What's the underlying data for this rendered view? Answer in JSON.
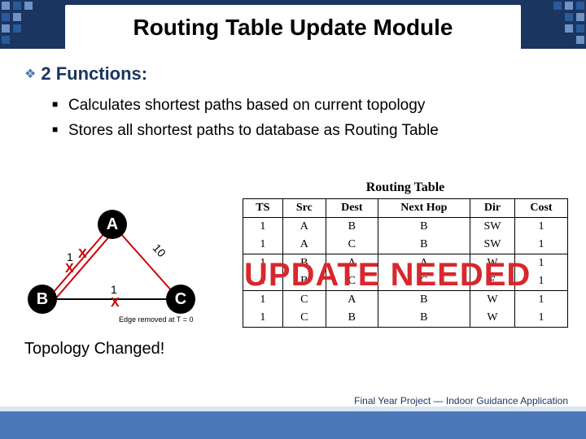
{
  "title": "Routing Table Update Module",
  "section": "2 Functions:",
  "bullets": [
    "Calculates shortest paths based on current topology",
    "Stores all shortest paths to database as Routing Table"
  ],
  "graph": {
    "nodeA": "A",
    "nodeB": "B",
    "nodeC": "C",
    "edgeAB": "1",
    "edgeBC": "1",
    "edgeAC": "10",
    "removed_caption": "Edge removed at T = 0"
  },
  "overlay": "UPDATE NEEDED",
  "topology_note": "Topology Changed!",
  "routing_table": {
    "title": "Routing Table",
    "headers": [
      "TS",
      "Src",
      "Dest",
      "Next Hop",
      "Dir",
      "Cost"
    ],
    "rows": [
      {
        "ts": "1",
        "src": "A",
        "dest": "B",
        "nh": "B",
        "dir": "SW",
        "cost": "1"
      },
      {
        "ts": "1",
        "src": "A",
        "dest": "C",
        "nh": "B",
        "dir": "SW",
        "cost": "1"
      },
      {
        "ts": "1",
        "src": "B",
        "dest": "A",
        "nh": "A",
        "dir": "W",
        "cost": "1"
      },
      {
        "ts": "1",
        "src": "B",
        "dest": "C",
        "nh": "C",
        "dir": "E",
        "cost": "1"
      },
      {
        "ts": "1",
        "src": "C",
        "dest": "A",
        "nh": "B",
        "dir": "W",
        "cost": "1"
      },
      {
        "ts": "1",
        "src": "C",
        "dest": "B",
        "nh": "B",
        "dir": "W",
        "cost": "1"
      }
    ]
  },
  "footer": "Final Year Project — Indoor Guidance Application",
  "colors": {
    "banner": "#1a355f",
    "accent": "#4b78b8",
    "red": "#d8272d"
  },
  "chart_data": {
    "type": "table",
    "title": "Routing Table",
    "columns": [
      "TS",
      "Src",
      "Dest",
      "Next Hop",
      "Dir",
      "Cost"
    ],
    "rows": [
      [
        1,
        "A",
        "B",
        "B",
        "SW",
        1
      ],
      [
        1,
        "A",
        "C",
        "B",
        "SW",
        1
      ],
      [
        1,
        "B",
        "A",
        "A",
        "W",
        1
      ],
      [
        1,
        "B",
        "C",
        "C",
        "E",
        1
      ],
      [
        1,
        "C",
        "A",
        "B",
        "W",
        1
      ],
      [
        1,
        "C",
        "B",
        "B",
        "W",
        1
      ]
    ]
  }
}
